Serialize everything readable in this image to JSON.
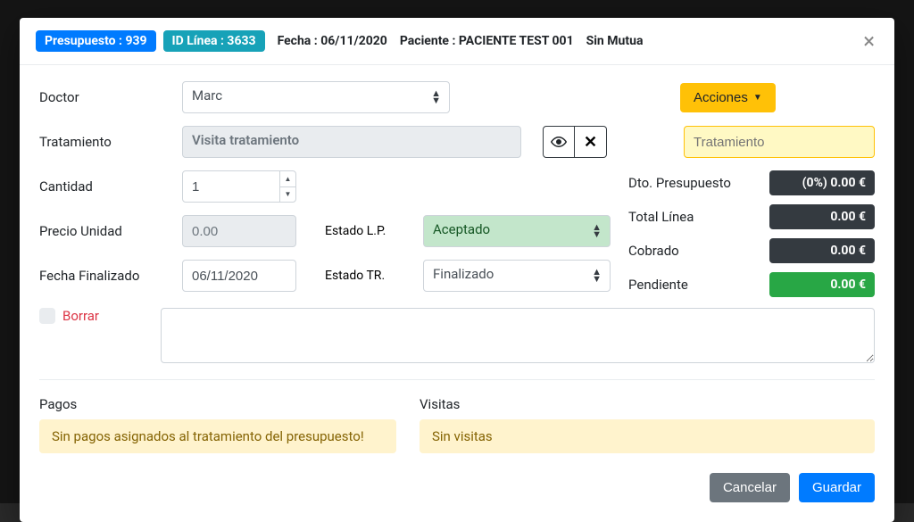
{
  "header": {
    "presupuesto_label": "Presupuesto : 939",
    "linea_label": "ID Línea : 3633",
    "fecha_label": "Fecha : 06/11/2020",
    "paciente_label": "Paciente : PACIENTE TEST 001",
    "mutua_label": "Sin Mutua"
  },
  "actions_button": "Acciones",
  "labels": {
    "doctor": "Doctor",
    "tratamiento": "Tratamiento",
    "cantidad": "Cantidad",
    "precio_unidad": "Precio Unidad",
    "fecha_finalizado": "Fecha Finalizado",
    "estado_lp": "Estado L.P.",
    "estado_tr": "Estado TR.",
    "dto_presupuesto": "Dto. Presupuesto",
    "total_linea": "Total Línea",
    "cobrado": "Cobrado",
    "pendiente": "Pendiente",
    "borrar": "Borrar",
    "pagos": "Pagos",
    "visitas": "Visitas"
  },
  "values": {
    "doctor": "Marc",
    "tratamiento": "Visita tratamiento",
    "tratamiento_placeholder": "Tratamiento",
    "cantidad": "1",
    "precio_unidad": "0.00",
    "fecha_finalizado": "06/11/2020",
    "estado_lp": "Aceptado",
    "estado_tr": "Finalizado",
    "dto_presupuesto": "(0%) 0.00 €",
    "total_linea": "0.00 €",
    "cobrado": "0.00 €",
    "pendiente": "0.00 €"
  },
  "alerts": {
    "sin_pagos": "Sin pagos asignados al tratamiento del presupuesto!",
    "sin_visitas": "Sin visitas"
  },
  "footer": {
    "cancelar": "Cancelar",
    "guardar": "Guardar"
  }
}
